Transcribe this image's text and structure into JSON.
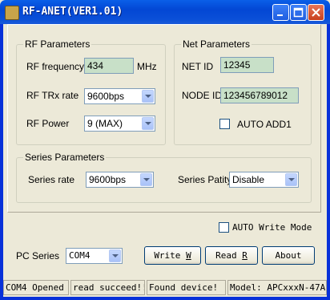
{
  "window": {
    "title": "RF-ANET(VER1.01)"
  },
  "rf": {
    "group_title": "RF Parameters",
    "frequency_label": "RF frequency",
    "frequency_value": "434",
    "frequency_unit": "MHz",
    "trx_label": "RF TRx rate",
    "trx_value": "9600bps",
    "power_label": "RF Power",
    "power_value": "9 (MAX)"
  },
  "net": {
    "group_title": "Net Parameters",
    "netid_label": "NET ID",
    "netid_value": "12345",
    "nodeid_label": "NODE ID",
    "nodeid_value": "123456789012",
    "auto_add_label": "AUTO ADD1"
  },
  "series": {
    "group_title": "Series Parameters",
    "rate_label": "Series rate",
    "rate_value": "9600bps",
    "parity_label": "Series Patity",
    "parity_value": "Disable"
  },
  "auto_write_label": "AUTO Write Mode",
  "pc_series": {
    "label": "PC Series",
    "value": "COM4"
  },
  "buttons": {
    "write": "Write W",
    "read": "Read R",
    "about": "About"
  },
  "status": [
    "COM4 Opened",
    "read succeed!!",
    "Found device!",
    "Model: APCxxxN-47A"
  ]
}
